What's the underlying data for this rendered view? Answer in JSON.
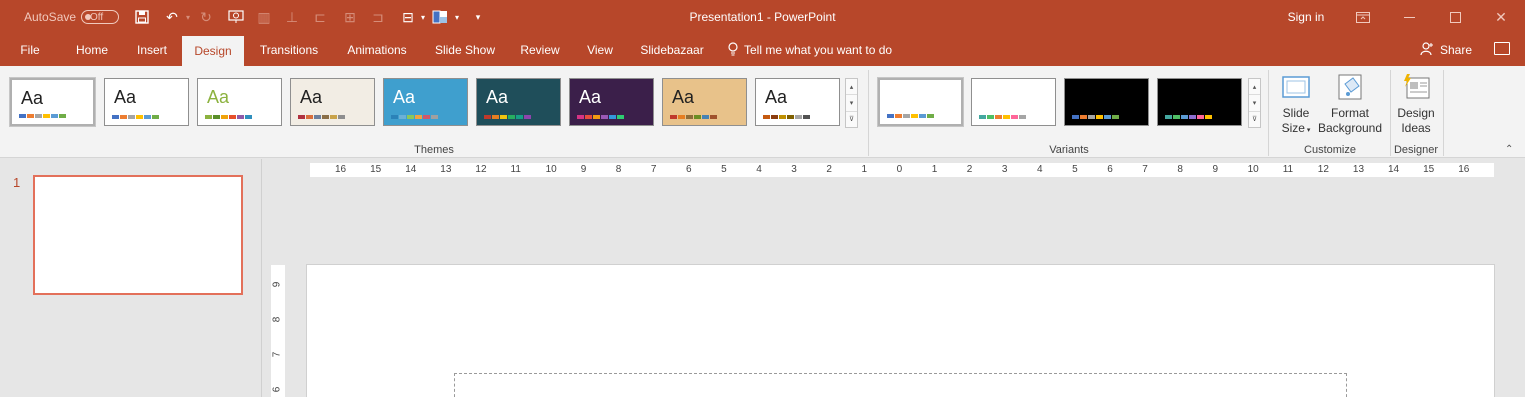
{
  "window": {
    "autosave_label": "AutoSave",
    "autosave_state": "Off",
    "title": "Presentation1  -  PowerPoint",
    "signin": "Sign in"
  },
  "tabs": [
    {
      "label": "File",
      "active": false
    },
    {
      "label": "Home",
      "active": false
    },
    {
      "label": "Insert",
      "active": false
    },
    {
      "label": "Design",
      "active": true
    },
    {
      "label": "Transitions",
      "active": false
    },
    {
      "label": "Animations",
      "active": false
    },
    {
      "label": "Slide Show",
      "active": false
    },
    {
      "label": "Review",
      "active": false
    },
    {
      "label": "View",
      "active": false
    },
    {
      "label": "Slidebazaar",
      "active": false
    }
  ],
  "tell_me": "Tell me what you want to do",
  "share": "Share",
  "ribbon": {
    "themes_label": "Themes",
    "variants_label": "Variants",
    "customize_label": "Customize",
    "designer_label": "Designer",
    "slide_size": [
      "Slide",
      "Size"
    ],
    "format_background": [
      "Format",
      "Background"
    ],
    "design_ideas": [
      "Design",
      "Ideas"
    ],
    "theme_sample_text": "Aa"
  },
  "themes": [
    {
      "bg": "#ffffff",
      "text_color": "#222222",
      "colors": [
        "#4472c4",
        "#ed7d31",
        "#a5a5a5",
        "#ffc000",
        "#5b9bd5",
        "#70ad47"
      ]
    },
    {
      "bg": "#ffffff",
      "text_color": "#222222",
      "colors": [
        "#4472c4",
        "#ed7d31",
        "#a5a5a5",
        "#ffc000",
        "#5b9bd5",
        "#70ad47"
      ]
    },
    {
      "bg": "#ffffff",
      "text_color": "#8cb23f",
      "colors": [
        "#8cb23f",
        "#5a8f2a",
        "#f0a30a",
        "#e64f2b",
        "#8f5aa8",
        "#2f8fbd"
      ]
    },
    {
      "bg": "#f2ede4",
      "text_color": "#222222",
      "colors": [
        "#b0313f",
        "#d96e3b",
        "#6d7f9c",
        "#8b6f47",
        "#c9a34a",
        "#8e8e8e"
      ]
    },
    {
      "bg": "#3f9fce",
      "text_color": "#ffffff",
      "colors": [
        "#2b82b8",
        "#6bb0d6",
        "#8ac75a",
        "#f1a340",
        "#d0576b",
        "#a0a0a0"
      ]
    },
    {
      "bg": "#1f4e5a",
      "text_color": "#ffffff",
      "colors": [
        "#c0392b",
        "#e67e22",
        "#f1c40f",
        "#27ae60",
        "#16a085",
        "#8e44ad"
      ]
    },
    {
      "bg": "#3b1f4a",
      "text_color": "#ffffff",
      "colors": [
        "#d63384",
        "#e74c3c",
        "#f39c12",
        "#9b59b6",
        "#3498db",
        "#2ecc71"
      ]
    },
    {
      "bg": "#e8c28a",
      "text_color": "#222222",
      "colors": [
        "#c0392b",
        "#e67e22",
        "#8e6d3a",
        "#6b8e23",
        "#4682b4",
        "#a0522d"
      ]
    },
    {
      "bg": "#ffffff",
      "text_color": "#222222",
      "colors": [
        "#c55a11",
        "#8c3d0e",
        "#bf9000",
        "#7f6000",
        "#a5a5a5",
        "#525252"
      ]
    }
  ],
  "variants": [
    {
      "bg": "#ffffff",
      "colors": [
        "#4472c4",
        "#ed7d31",
        "#a5a5a5",
        "#ffc000",
        "#5b9bd5",
        "#70ad47"
      ]
    },
    {
      "bg": "#ffffff",
      "colors": [
        "#44a8a0",
        "#4fbf64",
        "#ed7d31",
        "#ffc000",
        "#ff6699",
        "#a5a5a5"
      ]
    },
    {
      "bg": "#000000",
      "colors": [
        "#4472c4",
        "#ed7d31",
        "#a5a5a5",
        "#ffc000",
        "#5b9bd5",
        "#70ad47"
      ]
    },
    {
      "bg": "#000000",
      "colors": [
        "#44a8a0",
        "#4fbf64",
        "#5b9bd5",
        "#8e6fd1",
        "#ff6699",
        "#ffc000"
      ]
    }
  ],
  "slides": [
    {
      "number": "1"
    }
  ],
  "ruler": {
    "horizontal": [
      "16",
      "15",
      "14",
      "13",
      "12",
      "11",
      "10",
      "9",
      "8",
      "7",
      "6",
      "5",
      "4",
      "3",
      "2",
      "1",
      "0",
      "1",
      "2",
      "3",
      "4",
      "5",
      "6",
      "7",
      "8",
      "9",
      "10",
      "11",
      "12",
      "13",
      "14",
      "15",
      "16"
    ],
    "vertical": [
      "9",
      "8",
      "7",
      "6"
    ]
  }
}
